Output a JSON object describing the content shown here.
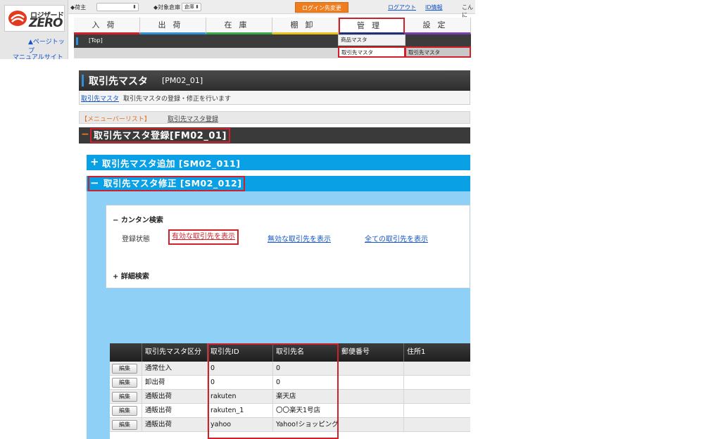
{
  "logo": {
    "line1": "ロジザード",
    "line2": "ZERO"
  },
  "side_links": {
    "page_top": "▲ページトップ",
    "manual": "マニュアルサイト"
  },
  "header": {
    "shipper_label": "◆荷主",
    "warehouse_label": "◆対象倉庫",
    "warehouse_value": "倉庫",
    "login_change": "ログイン先変更",
    "logout": "ログアウト",
    "id_info": "ID情報",
    "greeting": "こんに"
  },
  "tabs": [
    {
      "label": "入荷",
      "color": "#d0202a"
    },
    {
      "label": "出荷",
      "color": "#2f8fd8"
    },
    {
      "label": "在庫",
      "color": "#3aa84a"
    },
    {
      "label": "棚卸",
      "color": "#e6c21a"
    },
    {
      "label": "管理",
      "color": "#1f2f7a"
    },
    {
      "label": "設定",
      "color": "#7a3fa8"
    }
  ],
  "subnav": {
    "top": "[Top]"
  },
  "dropdown": {
    "product_master": "商品マスタ",
    "partner_master": "取引先マスタ",
    "partner_master_sub": "取引先マスタ"
  },
  "page": {
    "title": "取引先マスタ",
    "code": "[PM02_01]",
    "crumb_link": "取引先マスタ",
    "crumb_desc": "取引先マスタの登録・修正を行います",
    "menu_list": "【メニューバーリスト】",
    "menu_reg": "取引先マスタ登録"
  },
  "sections": {
    "fm_title": "取引先マスタ登録[FM02_01]",
    "sm_add": "取引先マスタ追加 [SM02_011]",
    "sm_edit": "取引先マスタ修正 [SM02_012]"
  },
  "search": {
    "easy_title": "カンタン検索",
    "status_label": "登録状態",
    "valid": "有効な取引先を表示",
    "invalid": "無効な取引先を表示",
    "all": "全ての取引先を表示",
    "detail_title": "詳細検索"
  },
  "table": {
    "edit_label": "編集",
    "columns": [
      "取引先マスタ区分",
      "取引先ID",
      "取引先名",
      "郵便番号",
      "住所1"
    ],
    "rows": [
      {
        "type": "通常仕入",
        "id": "0",
        "name": "0"
      },
      {
        "type": "卸出荷",
        "id": "0",
        "name": "0"
      },
      {
        "type": "通販出荷",
        "id": "rakuten",
        "name": "楽天店"
      },
      {
        "type": "通販出荷",
        "id": "rakuten_1",
        "name": "〇〇楽天1号店"
      },
      {
        "type": "通販出荷",
        "id": "yahoo",
        "name": "Yahoo!ショッピング"
      }
    ]
  }
}
